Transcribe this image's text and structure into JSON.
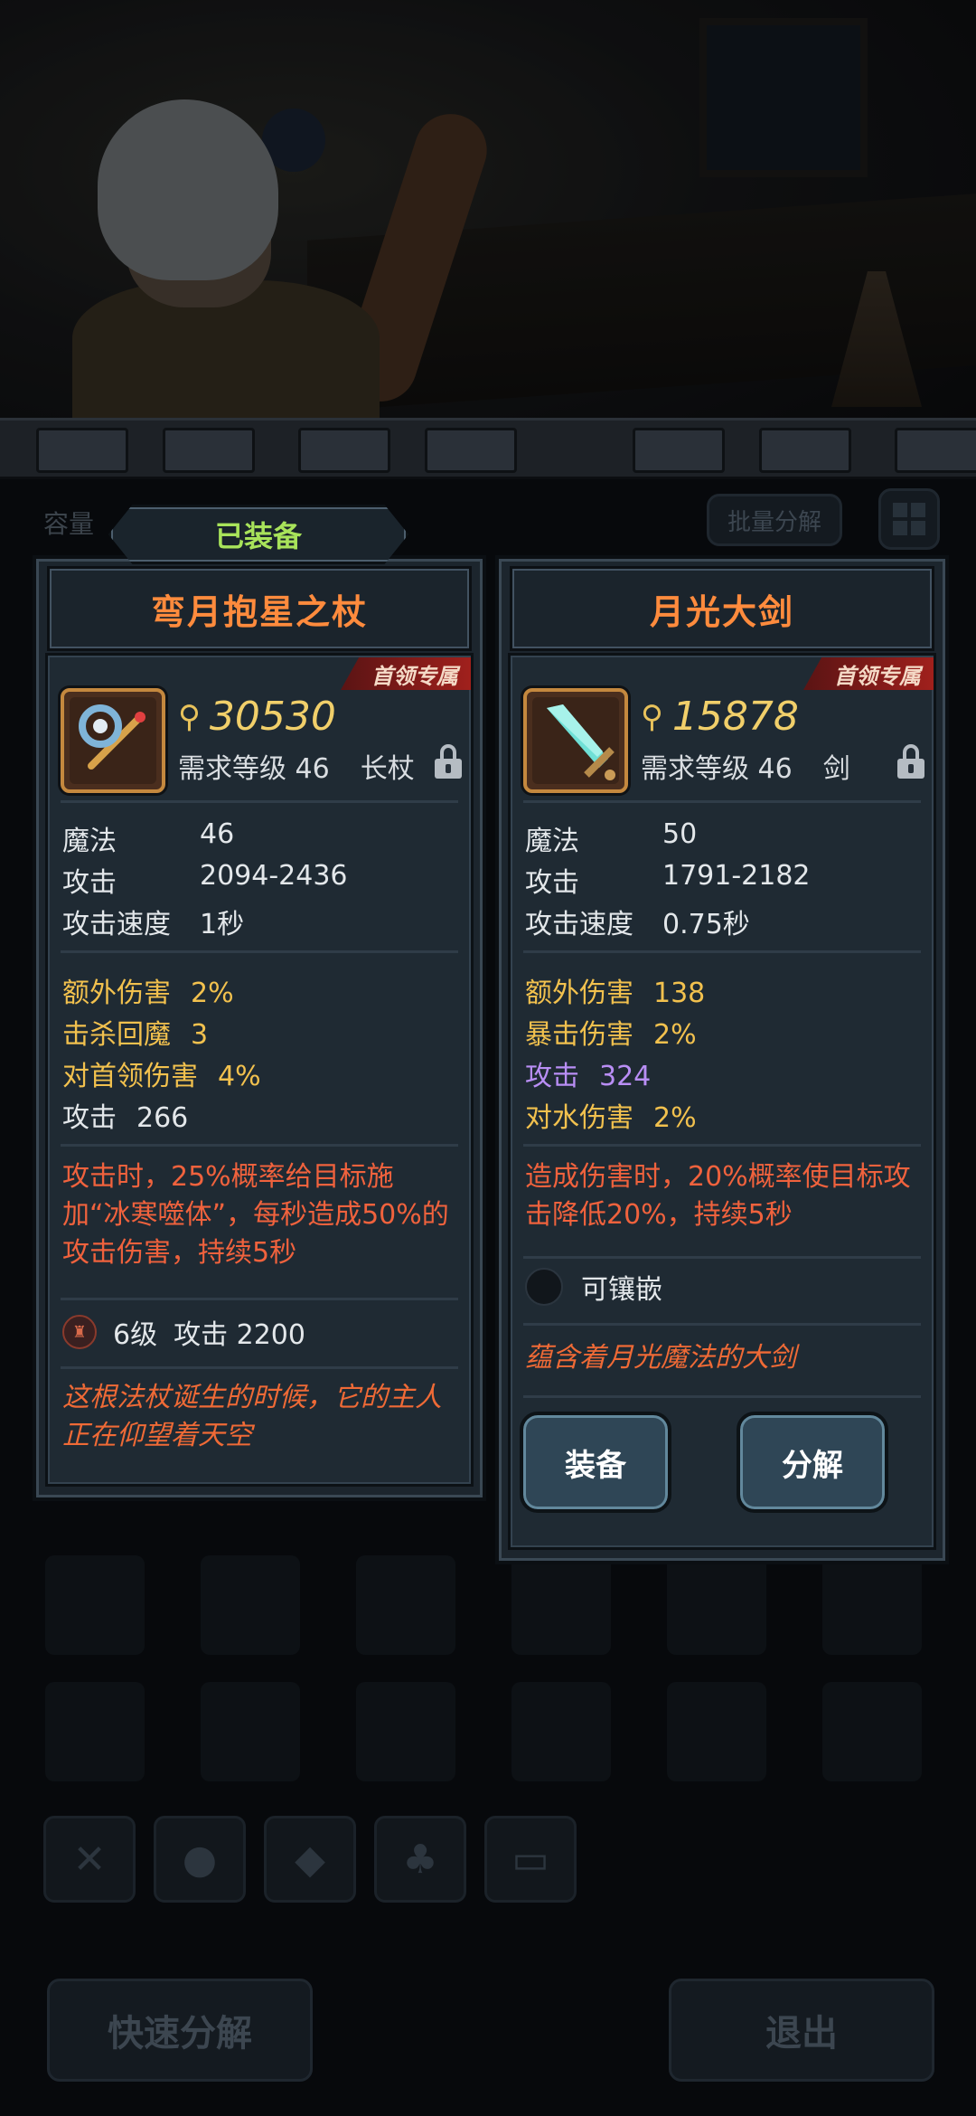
{
  "background": {
    "capacity_label": "容量",
    "batch_decompose_label": "批量分解",
    "quick_decompose_label": "快速分解",
    "exit_label": "退出",
    "category_icons": [
      "hammer-icon",
      "paw-icon",
      "gem-icon",
      "ore-icon",
      "chest-icon"
    ]
  },
  "equipped_tag": "已装备",
  "left_item": {
    "name": "弯月抱星之杖",
    "badge": "首领专属",
    "power": "30530",
    "requirement": "需求等级 46",
    "type": "长杖",
    "base_stats": [
      {
        "label": "魔法",
        "value": "46"
      },
      {
        "label": "攻击",
        "value": "2094-2436"
      },
      {
        "label": "攻击速度",
        "value": "1秒"
      }
    ],
    "extra_stats": [
      {
        "label": "额外伤害",
        "value": "2%"
      },
      {
        "label": "击杀回魔",
        "value": "3"
      },
      {
        "label": "对首领伤害",
        "value": "4%"
      },
      {
        "label": "攻击",
        "value": "266"
      }
    ],
    "effect": "攻击时，25%概率给目标施加“冰寒噬体”，每秒造成50%的攻击伤害，持续5秒",
    "set_level": "6级",
    "set_bonus": "攻击 2200",
    "lore": "这根法杖诞生的时候，它的主人正在仰望着天空"
  },
  "right_item": {
    "name": "月光大剑",
    "badge": "首领专属",
    "power": "15878",
    "requirement": "需求等级 46",
    "type": "剑",
    "base_stats": [
      {
        "label": "魔法",
        "value": "50"
      },
      {
        "label": "攻击",
        "value": "1791-2182"
      },
      {
        "label": "攻击速度",
        "value": "0.75秒"
      }
    ],
    "extra_stats": [
      {
        "label": "额外伤害",
        "value": "138"
      },
      {
        "label": "暴击伤害",
        "value": "2%"
      },
      {
        "label": "攻击",
        "value": "324"
      },
      {
        "label": "对水伤害",
        "value": "2%"
      }
    ],
    "effect": "造成伤害时，20%概率使目标攻击降低20%，持续5秒",
    "socket_label": "可镶嵌",
    "lore": "蕴含着月光魔法的大剑",
    "equip_button": "装备",
    "decompose_button": "分解"
  },
  "colors": {
    "title_orange": "#ff8b3d",
    "bonus_gold": "#f2c14e",
    "rare_purple": "#b98ef5",
    "effect_red": "#f0623d",
    "equipped_green": "#a8e35a",
    "badge_red": "#a0201c"
  }
}
